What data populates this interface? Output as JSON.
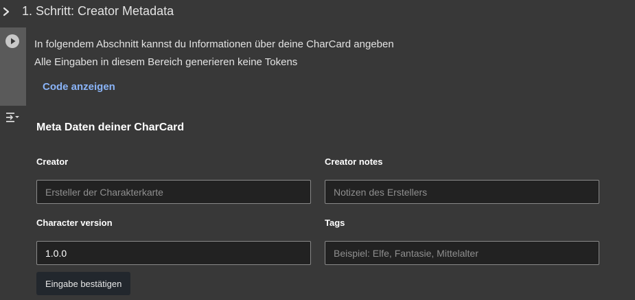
{
  "section": {
    "title": "1. Schritt: Creator Metadata"
  },
  "description": {
    "line1": "In folgendem Abschnitt kannst du Informationen über deine CharCard angeben",
    "line2": "Alle Eingaben in diesem Bereich generieren keine Tokens",
    "show_code_label": "Code anzeigen"
  },
  "form": {
    "title": "Meta Daten deiner CharCard",
    "creator": {
      "label": "Creator",
      "value": "",
      "placeholder": "Ersteller der Charakterkarte"
    },
    "creator_notes": {
      "label": "Creator notes",
      "value": "",
      "placeholder": "Notizen des Erstellers"
    },
    "character_version": {
      "label": "Character version",
      "value": "1.0.0",
      "placeholder": ""
    },
    "tags": {
      "label": "Tags",
      "value": "",
      "placeholder": "Beispiel: Elfe, Fantasie, Mittelalter"
    },
    "submit_label": "Eingabe bestätigen"
  },
  "icons": {
    "collapse": "chevron-right-icon",
    "run": "play-circle-icon",
    "toc": "table-of-contents-icon"
  },
  "colors": {
    "background": "#383838",
    "link": "#8ab4f8",
    "input_bg": "#222222",
    "button_bg": "#22272d"
  }
}
